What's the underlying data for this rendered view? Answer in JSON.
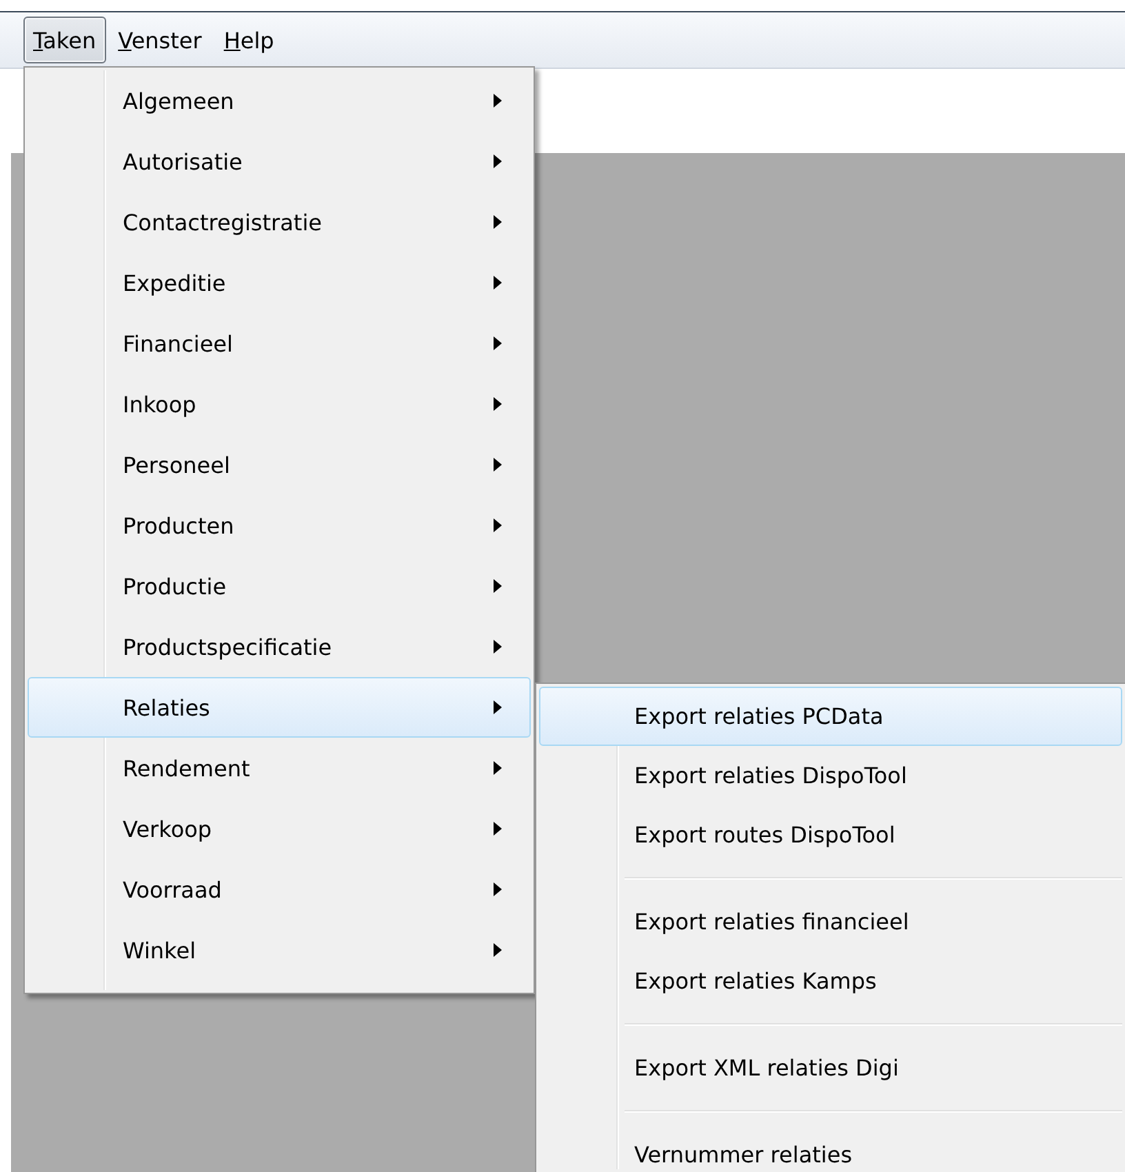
{
  "menu_bar": [
    {
      "label": "Taken",
      "selected": true,
      "mnemonic_first": true
    },
    {
      "label": "Venster",
      "selected": false,
      "mnemonic_first": true
    },
    {
      "label": "Help",
      "selected": false,
      "mnemonic_first": true
    }
  ],
  "menu": {
    "items": [
      {
        "label": "Algemeen",
        "selected": false,
        "has_submenu": true
      },
      {
        "label": "Autorisatie",
        "selected": false,
        "has_submenu": true
      },
      {
        "label": "Contactregistratie",
        "selected": false,
        "has_submenu": true
      },
      {
        "label": "Expeditie",
        "selected": false,
        "has_submenu": true
      },
      {
        "label": "Financieel",
        "selected": false,
        "has_submenu": true
      },
      {
        "label": "Inkoop",
        "selected": false,
        "has_submenu": true
      },
      {
        "label": "Personeel",
        "selected": false,
        "has_submenu": true
      },
      {
        "label": "Producten",
        "selected": false,
        "has_submenu": true
      },
      {
        "label": "Productie",
        "selected": false,
        "has_submenu": true
      },
      {
        "label": "Productspecificatie",
        "selected": false,
        "has_submenu": true
      },
      {
        "label": "Relaties",
        "selected": true,
        "has_submenu": true
      },
      {
        "label": "Rendement",
        "selected": false,
        "has_submenu": true
      },
      {
        "label": "Verkoop",
        "selected": false,
        "has_submenu": true
      },
      {
        "label": "Voorraad",
        "selected": false,
        "has_submenu": true
      },
      {
        "label": "Winkel",
        "selected": false,
        "has_submenu": true
      }
    ]
  },
  "submenu": {
    "items": [
      {
        "kind": "item",
        "label": "Export relaties PCData",
        "selected": true
      },
      {
        "kind": "item",
        "label": "Export relaties DispoTool",
        "selected": false
      },
      {
        "kind": "item",
        "label": "Export routes DispoTool",
        "selected": false
      },
      {
        "kind": "separator"
      },
      {
        "kind": "item",
        "label": "Export relaties financieel",
        "selected": false
      },
      {
        "kind": "item",
        "label": "Export relaties Kamps",
        "selected": false
      },
      {
        "kind": "separator"
      },
      {
        "kind": "item",
        "label": "Export XML relaties Digi",
        "selected": false
      },
      {
        "kind": "separator"
      },
      {
        "kind": "item",
        "label": "Vernummer relaties",
        "selected": false
      }
    ]
  }
}
